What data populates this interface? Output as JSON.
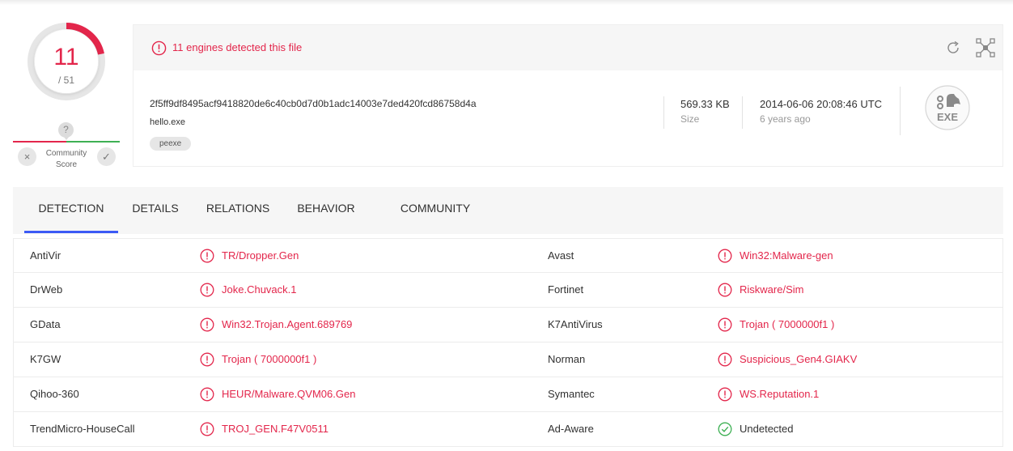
{
  "score": {
    "detected": "11",
    "total": "/ 51",
    "detected_ratio": 0.2157,
    "color": "#e3264b"
  },
  "community": {
    "unknown_icon": "?",
    "label": "Community Score",
    "downvote_icon": "×",
    "upvote_icon": "✓"
  },
  "summary": {
    "alert": "11 engines detected this file",
    "hash": "2f5ff9df8495acf9418820de6c40cb0d7d0b1adc14003e7ded420fcd86758d4a",
    "filename": "hello.exe",
    "tag": "peexe",
    "size_value": "569.33 KB",
    "size_label": "Size",
    "date_value": "2014-06-06 20:08:46 UTC",
    "date_ago": "6 years ago",
    "filetype_label": "EXE",
    "icons": [
      "alert-icon",
      "reanalyze-icon",
      "graph-icon",
      "exe-file-icon"
    ]
  },
  "tabs": [
    "DETECTION",
    "DETAILS",
    "RELATIONS",
    "BEHAVIOR",
    "COMMUNITY"
  ],
  "active_tab": "DETECTION",
  "colors": {
    "malicious": "#e3264b",
    "undetected": "#3eb054",
    "accent": "#3c5af5"
  },
  "results": [
    {
      "left": {
        "engine": "AntiVir",
        "verdict": "TR/Dropper.Gen",
        "status": "malicious"
      },
      "right": {
        "engine": "Avast",
        "verdict": "Win32:Malware-gen",
        "status": "malicious"
      }
    },
    {
      "left": {
        "engine": "DrWeb",
        "verdict": "Joke.Chuvack.1",
        "status": "malicious"
      },
      "right": {
        "engine": "Fortinet",
        "verdict": "Riskware/Sim",
        "status": "malicious"
      }
    },
    {
      "left": {
        "engine": "GData",
        "verdict": "Win32.Trojan.Agent.689769",
        "status": "malicious"
      },
      "right": {
        "engine": "K7AntiVirus",
        "verdict": "Trojan ( 7000000f1 )",
        "status": "malicious"
      }
    },
    {
      "left": {
        "engine": "K7GW",
        "verdict": "Trojan ( 7000000f1 )",
        "status": "malicious"
      },
      "right": {
        "engine": "Norman",
        "verdict": "Suspicious_Gen4.GIAKV",
        "status": "malicious"
      }
    },
    {
      "left": {
        "engine": "Qihoo-360",
        "verdict": "HEUR/Malware.QVM06.Gen",
        "status": "malicious"
      },
      "right": {
        "engine": "Symantec",
        "verdict": "WS.Reputation.1",
        "status": "malicious"
      }
    },
    {
      "left": {
        "engine": "TrendMicro-HouseCall",
        "verdict": "TROJ_GEN.F47V0511",
        "status": "malicious"
      },
      "right": {
        "engine": "Ad-Aware",
        "verdict": "Undetected",
        "status": "undetected"
      }
    }
  ]
}
